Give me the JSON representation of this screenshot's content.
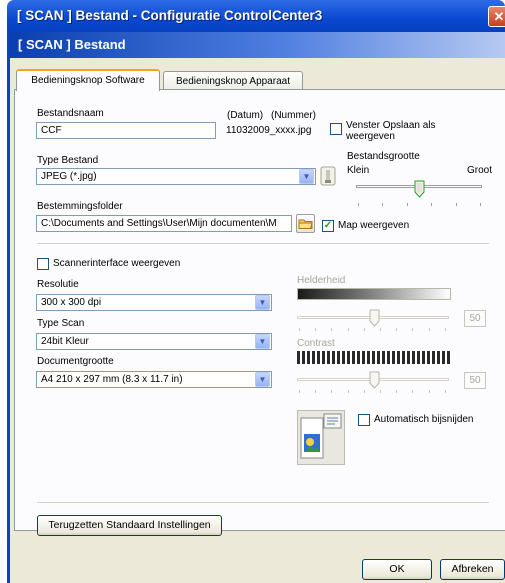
{
  "window": {
    "title": "[ SCAN ]  Bestand - Configuratie ControlCenter3",
    "close_glyph": "✕",
    "header": "[ SCAN ]  Bestand"
  },
  "tabs": [
    {
      "label": "Bedieningsknop Software",
      "active": true
    },
    {
      "label": "Bedieningsknop Apparaat",
      "active": false
    }
  ],
  "file": {
    "name_label": "Bestandsnaam",
    "name_value": "CCF",
    "datum_label": "(Datum)",
    "nummer_label": "(Nummer)",
    "suffix_value": "11032009_xxxx.jpg",
    "save_window_label": "Venster Opslaan als weergeven",
    "save_window_checked": false,
    "type_label": "Type Bestand",
    "type_value": "JPEG (*.jpg)",
    "size_label": "Bestandsgrootte",
    "size_small": "Klein",
    "size_large": "Groot",
    "size_level": 0.5,
    "folder_label": "Bestemmingsfolder",
    "folder_value": "C:\\Documents and Settings\\User\\Mijn documenten\\M",
    "show_folder_label": "Map weergeven",
    "show_folder_checked": true
  },
  "scan": {
    "scanner_interface_label": "Scannerinterface weergeven",
    "scanner_interface_checked": false,
    "resolution_label": "Resolutie",
    "resolution_value": "300 x 300 dpi",
    "scan_type_label": "Type Scan",
    "scan_type_value": "24bit Kleur",
    "doc_size_label": "Documentgrootte",
    "doc_size_value": "A4 210 x 297 mm (8.3 x 11.7 in)",
    "brightness_label": "Helderheid",
    "brightness_value": "50",
    "contrast_label": "Contrast",
    "contrast_value": "50",
    "auto_crop_label": "Automatisch bijsnijden",
    "auto_crop_checked": false
  },
  "buttons": {
    "reset": "Terugzetten Standaard Instellingen",
    "ok": "OK",
    "cancel": "Afbreken"
  },
  "icons": [
    "close-icon",
    "dropdown-arrow-icon",
    "file-size-icon",
    "browse-folder-icon",
    "checkmark-icon",
    "scan-document-icon"
  ],
  "colors": {
    "titlebar": "#0a48d0",
    "accent_tab": "#f0a52a",
    "check": "#21a121"
  }
}
